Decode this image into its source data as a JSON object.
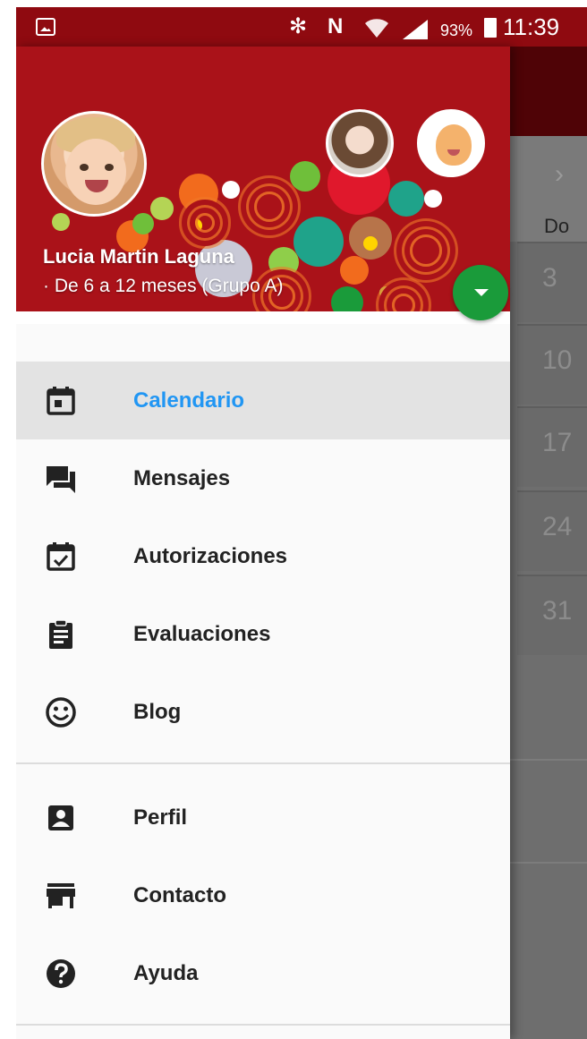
{
  "status_bar": {
    "battery_percent": "93%",
    "time": "11:39",
    "icons": [
      "image-icon",
      "bluetooth-icon",
      "nfc-icon",
      "wifi-icon",
      "signal-icon",
      "battery-icon"
    ]
  },
  "background_calendar": {
    "day_header": "Do",
    "days": [
      "3",
      "10",
      "17",
      "24",
      "31"
    ]
  },
  "drawer": {
    "header": {
      "user_name": "Lucia Martin Laguna",
      "user_group": "· De 6 a 12 meses (Grupo A)",
      "background_color": "#aa1219"
    },
    "menu": [
      {
        "label": "Calendario",
        "icon": "calendar-icon",
        "active": true
      },
      {
        "label": "Mensajes",
        "icon": "chat-icon",
        "active": false
      },
      {
        "label": "Autorizaciones",
        "icon": "calendar-check-icon",
        "active": false
      },
      {
        "label": "Evaluaciones",
        "icon": "clipboard-icon",
        "active": false
      },
      {
        "label": "Blog",
        "icon": "smiley-icon",
        "active": false
      }
    ],
    "secondary_menu": [
      {
        "label": "Perfil",
        "icon": "contact-card-icon"
      },
      {
        "label": "Contacto",
        "icon": "store-icon"
      },
      {
        "label": "Ayuda",
        "icon": "help-icon"
      }
    ],
    "accent_color": "#2196f3"
  }
}
